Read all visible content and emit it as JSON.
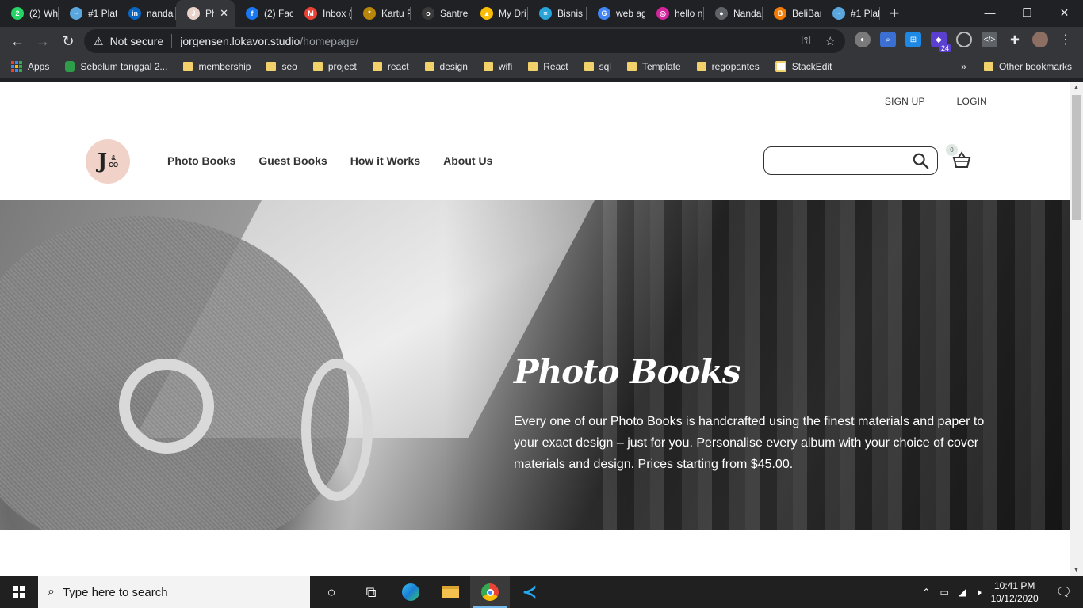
{
  "tabs": [
    {
      "title": "(2) Wh",
      "icon": "whatsapp-icon",
      "color": "#25d366",
      "glyph": "2"
    },
    {
      "title": "#1 Plat",
      "icon": "platform-icon",
      "color": "#5aa7e0",
      "glyph": "~"
    },
    {
      "title": "nanda",
      "icon": "linkedin-icon",
      "color": "#0a66c2",
      "glyph": "in"
    },
    {
      "title": "Pho",
      "icon": "jco-icon",
      "color": "#e9d2c9",
      "glyph": "J",
      "active": true
    },
    {
      "title": "(2) Fac",
      "icon": "facebook-icon",
      "color": "#1877f2",
      "glyph": "f"
    },
    {
      "title": "Inbox (",
      "icon": "gmail-icon",
      "color": "#ea4335",
      "glyph": "M"
    },
    {
      "title": "Kartu P",
      "icon": "garuda-icon",
      "color": "#b8860b",
      "glyph": "*"
    },
    {
      "title": "Santre",
      "icon": "santre-icon",
      "color": "#3a3a3a",
      "glyph": "o"
    },
    {
      "title": "My Dri",
      "icon": "drive-icon",
      "color": "#fbbc05",
      "glyph": "▲"
    },
    {
      "title": "Bisnis",
      "icon": "bisnis-icon",
      "color": "#2aa3d8",
      "glyph": "≡"
    },
    {
      "title": "web ag",
      "icon": "google-icon",
      "color": "#4285f4",
      "glyph": "G"
    },
    {
      "title": "hello n",
      "icon": "instagram-icon",
      "color": "#d6249f",
      "glyph": "◎"
    },
    {
      "title": "Nanda",
      "icon": "globe-icon",
      "color": "#5f6368",
      "glyph": "●"
    },
    {
      "title": "BeliBar",
      "icon": "belibar-icon",
      "color": "#f57c00",
      "glyph": "B"
    },
    {
      "title": "#1 Plat",
      "icon": "platform-icon",
      "color": "#5aa7e0",
      "glyph": "~"
    }
  ],
  "window": {
    "minimize": "—",
    "restore": "❐",
    "close": "✕"
  },
  "address": {
    "security_label": "Not secure",
    "host": "jorgensen.lokavor.studio",
    "path": "/homepage/"
  },
  "bookmarks": {
    "apps_label": "Apps",
    "items": [
      "Sebelum tanggal 2...",
      "membership",
      "seo",
      "project",
      "react",
      "design",
      "wifi",
      "React",
      "sql",
      "Template",
      "regopantes",
      "StackEdit"
    ],
    "overflow": "»",
    "other": "Other bookmarks"
  },
  "extensions": {
    "badge": "24"
  },
  "site": {
    "signup": "SIGN UP",
    "login": "LOGIN",
    "logo_letter": "J",
    "logo_small": "&\nCO",
    "nav": [
      "Photo Books",
      "Guest Books",
      "How it Works",
      "About Us"
    ],
    "search_placeholder": "",
    "cart_count": "0",
    "hero": {
      "title": "Photo Books",
      "body": "Every one of our Photo Books is handcrafted using the finest materials and paper to your exact design – just for you.  Personalise every album with your choice of cover materials and design. Prices starting from $45.00."
    }
  },
  "taskbar": {
    "search_placeholder": "Type here to search",
    "time": "10:41 PM",
    "date": "10/12/2020"
  }
}
